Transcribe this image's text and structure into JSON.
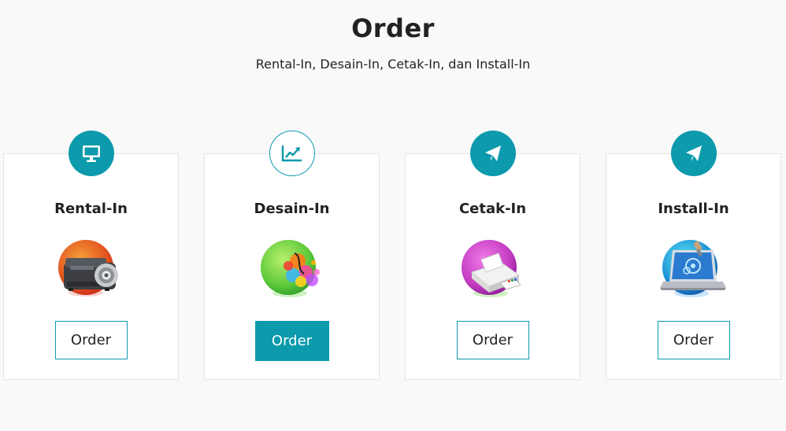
{
  "header": {
    "title": "Order",
    "subtitle": "Rental-In, Desain-In, Cetak-In, dan Install-In"
  },
  "cards": [
    {
      "title": "Rental-In",
      "icon": "monitor-icon",
      "illustration": "projector-illustration",
      "button_label": "Order"
    },
    {
      "title": "Desain-In",
      "icon": "line-chart-icon",
      "illustration": "paint-splash-illustration",
      "button_label": "Order"
    },
    {
      "title": "Cetak-In",
      "icon": "paper-plane-icon",
      "illustration": "printer-illustration",
      "button_label": "Order"
    },
    {
      "title": "Install-In",
      "icon": "paper-plane-icon",
      "illustration": "laptop-install-illustration",
      "button_label": "Order"
    }
  ],
  "colors": {
    "accent": "#0c9aac",
    "background": "#f9f9f9"
  }
}
